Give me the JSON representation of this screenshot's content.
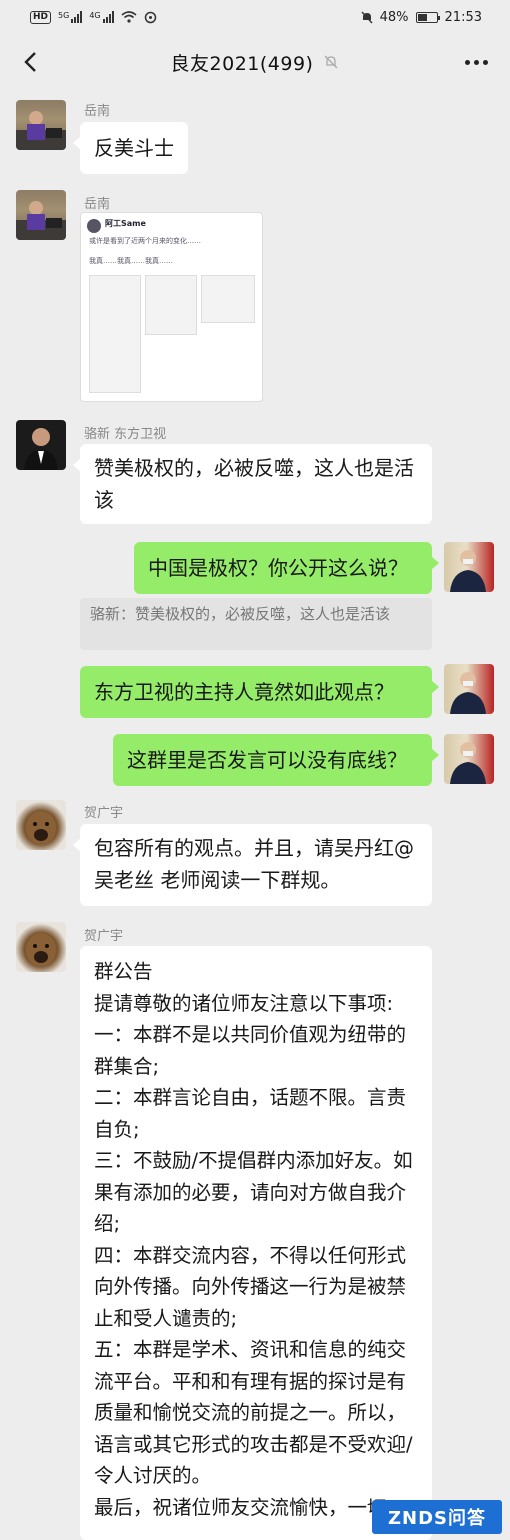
{
  "status_bar": {
    "carrier_badge": "HD",
    "network_labels": [
      "5G",
      "4G"
    ],
    "battery_pct": "48%",
    "time": "21:53"
  },
  "header": {
    "title": "良友2021(499)",
    "icons": [
      "back-arrow-icon",
      "mute-bell-icon",
      "more-dots-icon"
    ]
  },
  "messages": [
    {
      "sender": "岳南",
      "text": "反美斗士"
    },
    {
      "sender": "岳南",
      "image_text": [
        "阿工Same",
        "或许是看到了近两个月来的变化……",
        "我真……我真……我真……"
      ]
    },
    {
      "sender": "骆新 东方卫视",
      "text": "赞美极权的，必被反噬，这人也是活该"
    },
    {
      "text": "中国是极权？你公开这么说？",
      "quote": "骆新：赞美极权的，必被反噬，这人也是活该"
    },
    {
      "text": "东方卫视的主持人竟然如此观点？"
    },
    {
      "text": "这群里是否发言可以没有底线？"
    },
    {
      "sender": "贺广宇",
      "text": "包容所有的观点。并且，请吴丹红@吴老丝  老师阅读一下群规。"
    },
    {
      "sender": "贺广宇",
      "lines": [
        "群公告",
        "提请尊敬的诸位师友注意以下事项:",
        "一：本群不是以共同价值观为纽带的群集合;",
        "二：本群言论自由，话题不限。言责自负;",
        "三：不鼓励/不提倡群内添加好友。如果有添加的必要，请向对方做自我介绍;",
        "四：本群交流内容，不得以任何形式向外传播。向外传播这一行为是被禁止和受人谴责的;",
        "五：本群是学术、资讯和信息的纯交流平台。平和和有理有据的探讨是有质量和愉悦交流的前提之一。所以，语言或其它形式的攻击都是不受欢迎/令人讨厌的。",
        "最后，祝诸位师友交流愉快，一切"
      ]
    }
  ],
  "watermark": "ZNDS问答",
  "colors": {
    "bubble_self": "#95ec69",
    "bubble_other": "#ffffff",
    "background": "#ededed"
  }
}
